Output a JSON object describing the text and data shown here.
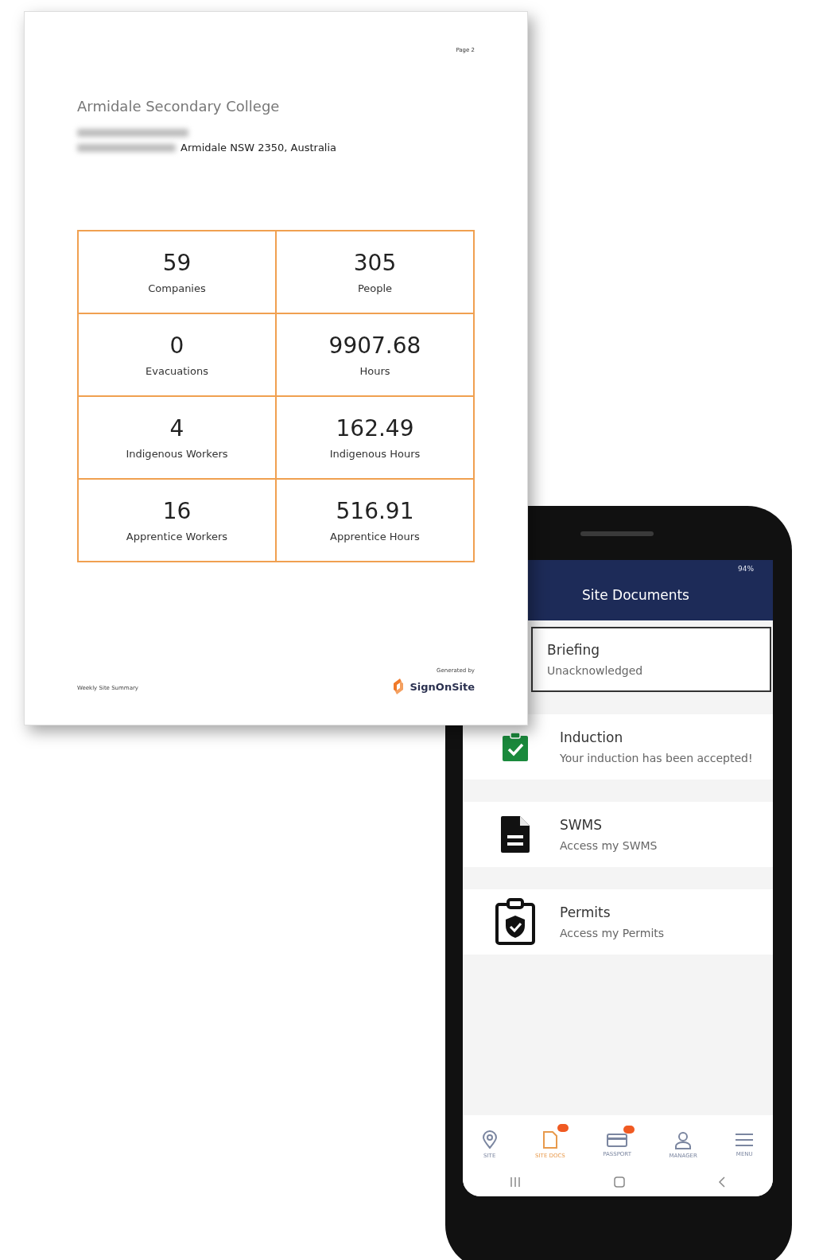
{
  "report": {
    "page_label": "Page 2",
    "site_name": "Armidale Secondary College",
    "address": "Armidale NSW 2350, Australia",
    "stats": [
      {
        "value": "59",
        "label": "Companies"
      },
      {
        "value": "305",
        "label": "People"
      },
      {
        "value": "0",
        "label": "Evacuations"
      },
      {
        "value": "9907.68",
        "label": "Hours"
      },
      {
        "value": "4",
        "label": "Indigenous Workers"
      },
      {
        "value": "162.49",
        "label": "Indigenous Hours"
      },
      {
        "value": "16",
        "label": "Apprentice Workers"
      },
      {
        "value": "516.91",
        "label": "Apprentice Hours"
      }
    ],
    "footer": "Weekly Site Summary",
    "generated_by": "Generated by",
    "brand": "SignOnSite"
  },
  "phone": {
    "battery": "94%",
    "title": "Site Documents",
    "documents": [
      {
        "title": "Briefing",
        "subtitle": "Unacknowledged",
        "selected": true
      },
      {
        "kind": "accepted",
        "title": "Induction",
        "subtitle": "Your induction has been accepted!",
        "selected": false
      },
      {
        "kind": "document",
        "title": "SWMS",
        "subtitle": "Access my SWMS",
        "selected": false
      },
      {
        "kind": "permit",
        "title": "Permits",
        "subtitle": "Access my Permits",
        "selected": false
      }
    ],
    "nav": [
      {
        "kind": "pin",
        "label": "SITE",
        "selected": false,
        "badge": false
      },
      {
        "kind": "docs",
        "label": "SITE DOCS",
        "selected": true,
        "badge": true
      },
      {
        "kind": "card",
        "label": "PASSPORT",
        "selected": false,
        "badge": true
      },
      {
        "kind": "person",
        "label": "MANAGER",
        "selected": false,
        "badge": false
      },
      {
        "kind": "menu",
        "label": "MENU",
        "selected": false,
        "badge": false
      }
    ]
  }
}
